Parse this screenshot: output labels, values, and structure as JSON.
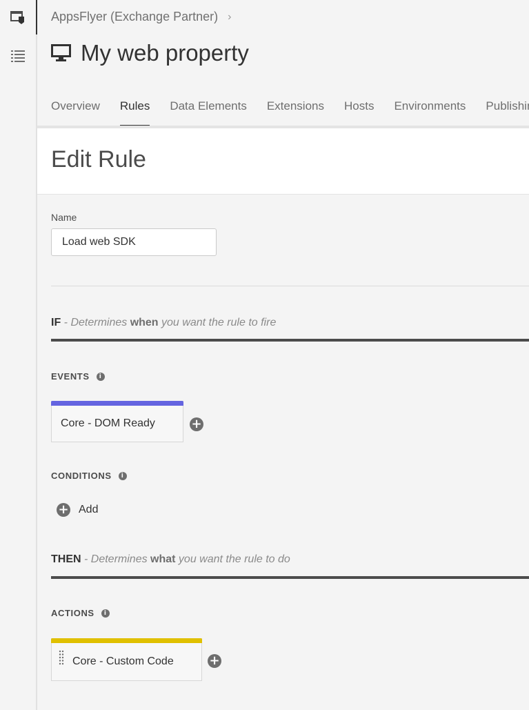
{
  "breadcrumb": {
    "company": "AppsFlyer (Exchange Partner)",
    "separator": "›"
  },
  "property": {
    "title": "My web property",
    "icon": "desktop-icon"
  },
  "rail": {
    "items": [
      {
        "icon": "property-tag-icon",
        "active": true
      },
      {
        "icon": "list-icon",
        "active": false
      }
    ]
  },
  "tabs": [
    {
      "label": "Overview"
    },
    {
      "label": "Rules",
      "active": true
    },
    {
      "label": "Data Elements"
    },
    {
      "label": "Extensions"
    },
    {
      "label": "Hosts"
    },
    {
      "label": "Environments"
    },
    {
      "label": "Publishing"
    }
  ],
  "page": {
    "title": "Edit Rule"
  },
  "form": {
    "name_label": "Name",
    "name_value": "Load web SDK"
  },
  "if_clause": {
    "keyword": "IF",
    "pre": " - Determines ",
    "em": "when",
    "post": " you want the rule to fire"
  },
  "then_clause": {
    "keyword": "THEN",
    "pre": " - Determines ",
    "em": "what",
    "post": " you want the rule to do"
  },
  "events": {
    "label": "EVENTS",
    "items": [
      {
        "name": "Core - DOM Ready",
        "color": "#6464e0"
      }
    ]
  },
  "conditions": {
    "label": "CONDITIONS",
    "add_label": "Add"
  },
  "actions": {
    "label": "ACTIONS",
    "items": [
      {
        "name": "Core - Custom Code",
        "color": "#e0c000"
      }
    ]
  },
  "colors": {
    "event_bar": "#6464e0",
    "action_bar": "#e0c000"
  }
}
